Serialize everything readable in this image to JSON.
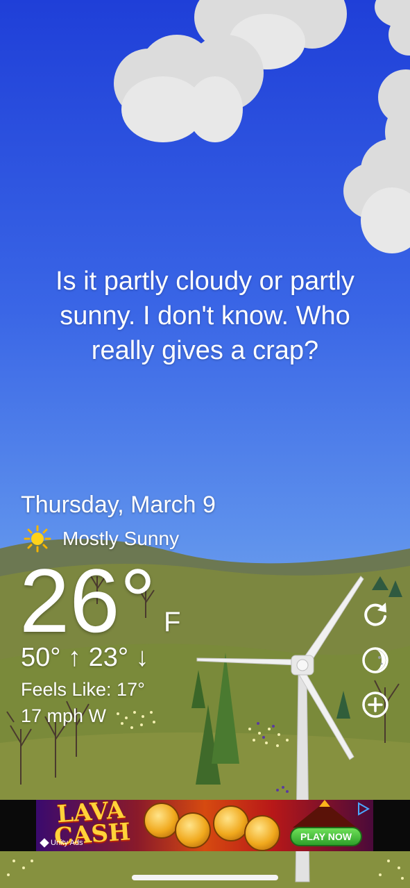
{
  "quote": "Is it partly cloudy or partly sunny. I don't know. Who really gives a crap?",
  "date": "Thursday, March 9",
  "condition": {
    "icon": "sun-icon",
    "text": "Mostly Sunny"
  },
  "current_temp": "26°",
  "unit": "F",
  "high_low": "50° ↑ 23° ↓",
  "feels_like": "Feels Like: 17°",
  "wind": "17 mph W",
  "side_buttons": [
    {
      "icon": "refresh-icon"
    },
    {
      "icon": "moon-icon"
    },
    {
      "icon": "add-circle-icon"
    }
  ],
  "ad": {
    "title": "LAVA CASH",
    "cta": "PLAY NOW",
    "brand": "Unity Ads",
    "icon": "ad-info-icon"
  },
  "colors": {
    "sky_top": "#1f3fd8",
    "sky_bottom": "#9fcaf4",
    "hill_far": "#6e7b52",
    "grass": "#7f8a3e",
    "ad_cta": "#2ea02a"
  }
}
